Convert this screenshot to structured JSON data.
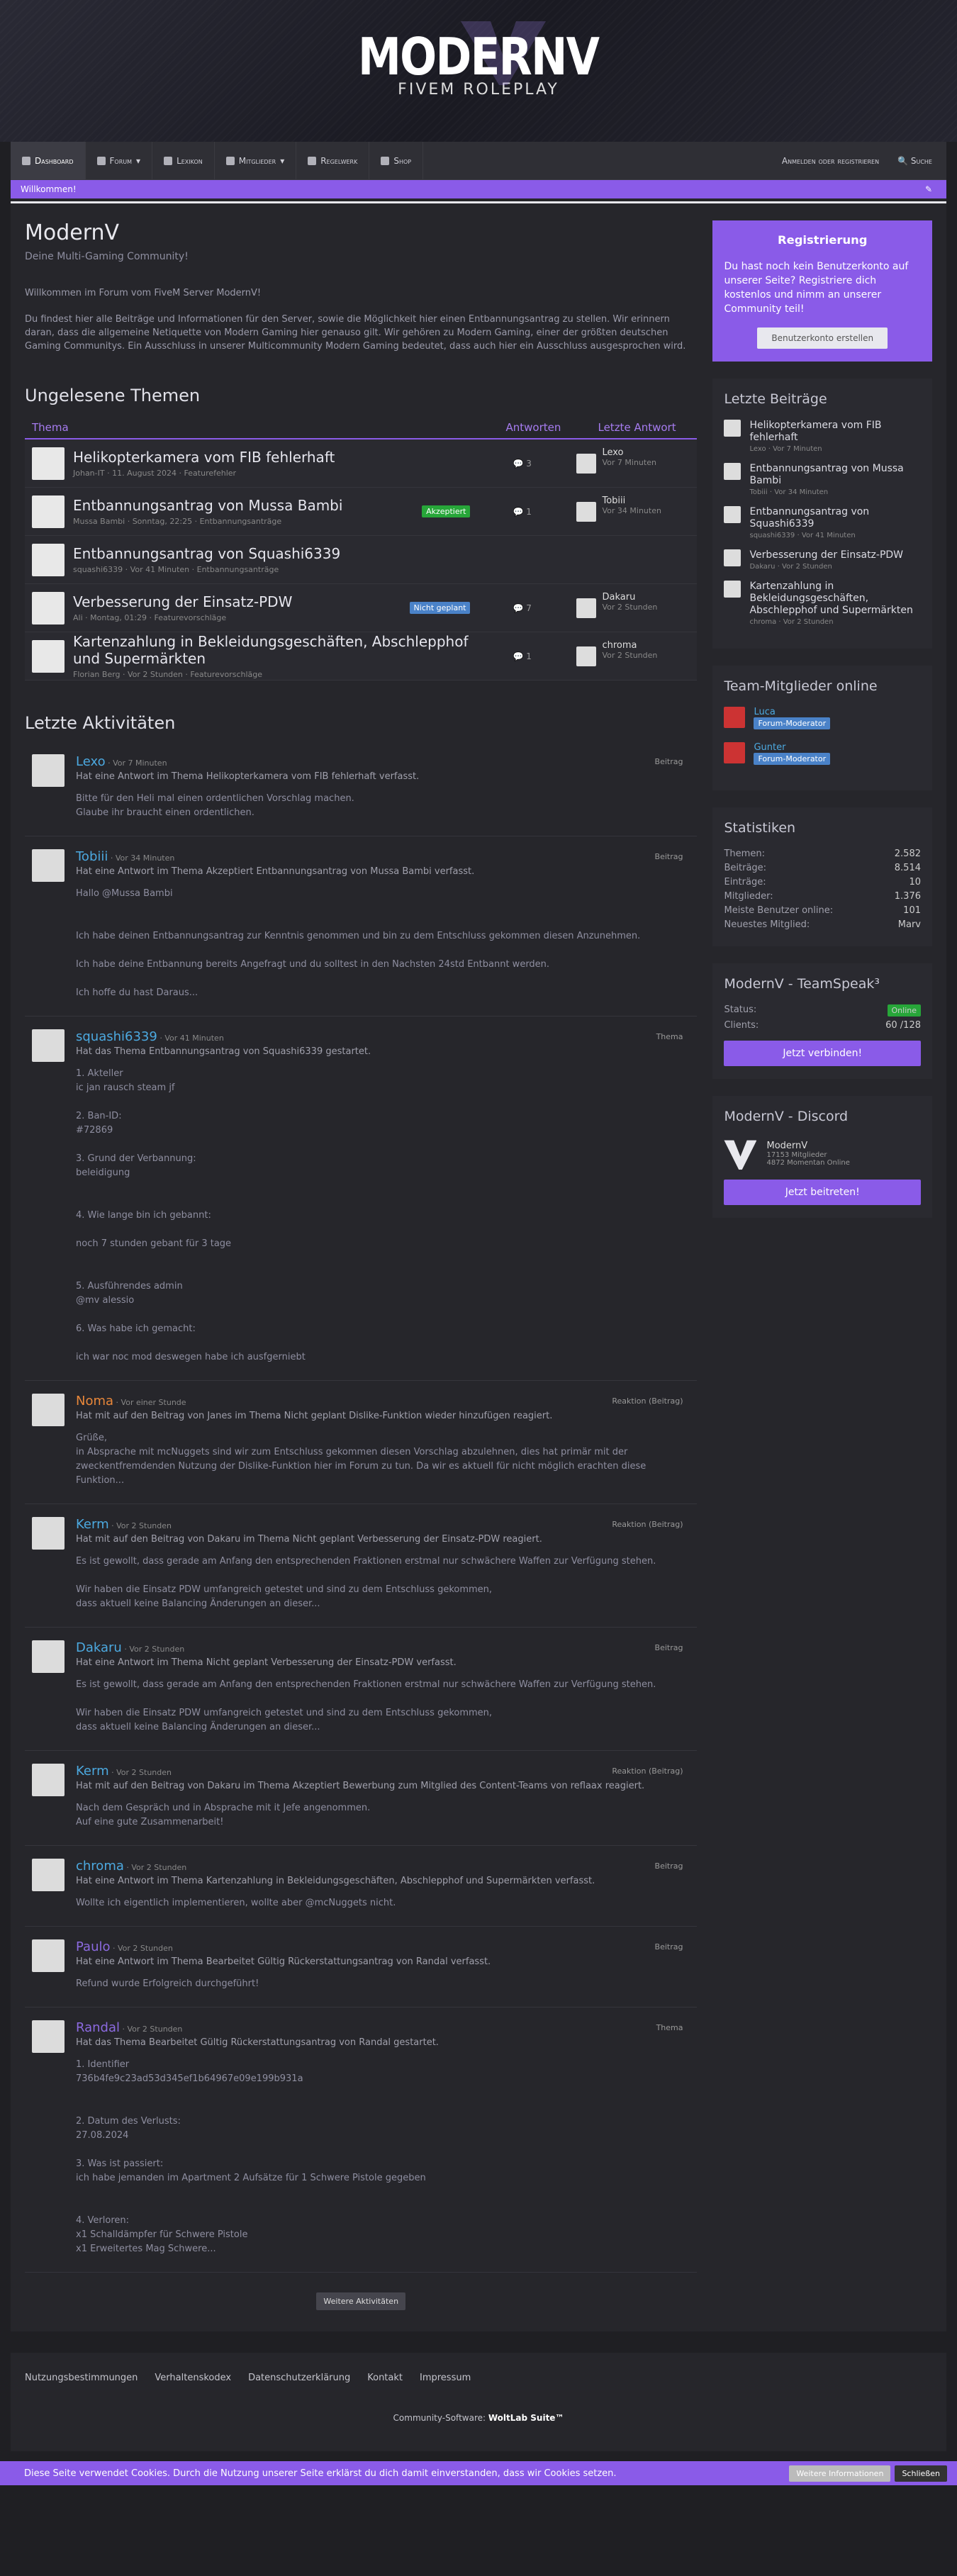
{
  "header": {
    "logo_big": "MODERNV",
    "logo_small": "FIVEM ROLEPLAY"
  },
  "nav": {
    "items": [
      {
        "label": "Dashboard"
      },
      {
        "label": "Forum"
      },
      {
        "label": "Lexikon"
      },
      {
        "label": "Mitglieder"
      },
      {
        "label": "Regelwerk"
      },
      {
        "label": "Shop"
      }
    ],
    "login": "Anmelden oder registrieren",
    "search": "Suche"
  },
  "welcome": {
    "text": "Willkommen!"
  },
  "page": {
    "title": "ModernV",
    "subtitle": "Deine Multi-Gaming Community!",
    "intro1": "Willkommen im Forum vom FiveM Server ModernV!",
    "intro2": "Du findest hier alle Beiträge und Informationen für den Server, sowie die Möglichkeit hier einen Entbannungsantrag zu stellen. Wir erinnern daran, dass die allgemeine Netiquette von Modern Gaming hier genauso gilt. Wir gehören zu Modern Gaming, einer der größten deutschen Gaming Communitys. Ein Ausschluss in unserer Multicommunity Modern Gaming bedeutet, dass auch hier ein Ausschluss ausgesprochen wird."
  },
  "unread": {
    "heading": "Ungelesene Themen",
    "col_topic": "Thema",
    "col_answers": "Antworten",
    "col_last": "Letzte Antwort",
    "rows": [
      {
        "title": "Helikopterkamera vom FIB fehlerhaft",
        "meta": "Johan-IT · 11. August 2024 · Featurefehler",
        "answers": "3",
        "last_user": "Lexo",
        "last_time": "Vor 7 Minuten",
        "badge": ""
      },
      {
        "title": "Entbannungsantrag von Mussa Bambi",
        "meta": "Mussa Bambi · Sonntag, 22:25 · Entbannungsanträge",
        "answers": "1",
        "last_user": "Tobiii",
        "last_time": "Vor 34 Minuten",
        "badge": "Akzeptiert"
      },
      {
        "title": "Entbannungsantrag von Squashi6339",
        "meta": "squashi6339 · Vor 41 Minuten · Entbannungsanträge",
        "answers": "",
        "last_user": "",
        "last_time": "",
        "badge": ""
      },
      {
        "title": "Verbesserung der Einsatz-PDW",
        "meta": "Ali · Montag, 01:29 · Featurevorschläge",
        "answers": "7",
        "last_user": "Dakaru",
        "last_time": "Vor 2 Stunden",
        "badge": "Nicht geplant"
      },
      {
        "title": "Kartenzahlung in Bekleidungsgeschäften, Abschlepphof und Supermärkten",
        "meta": "Florian Berg · Vor 2 Stunden · Featurevorschläge",
        "answers": "1",
        "last_user": "chroma",
        "last_time": "Vor 2 Stunden",
        "badge": ""
      }
    ]
  },
  "activity": {
    "heading": "Letzte Aktivitäten",
    "items": [
      {
        "user": "Lexo",
        "time": "Vor 7 Minuten",
        "type": "Beitrag",
        "line": "Hat eine Antwort im Thema Helikopterkamera vom FIB fehlerhaft verfasst.",
        "excerpt": "Bitte für den Heli mal einen ordentlichen Vorschlag machen.\nGlaube ihr braucht einen ordentlichen."
      },
      {
        "user": "Tobiii",
        "time": "Vor 34 Minuten",
        "type": "Beitrag",
        "line": "Hat eine Antwort im Thema Akzeptiert Entbannungsantrag von Mussa Bambi verfasst.",
        "excerpt": "Hallo @Mussa Bambi\n\n\nIch habe deinen Entbannungsantrag zur Kenntnis genommen und bin zu dem Entschluss gekommen diesen Anzunehmen.\n\nIch habe deine Entbannung bereits Angefragt und du solltest in den Nachsten 24std Entbannt werden.\n\nIch hoffe du hast Daraus..."
      },
      {
        "user": "squashi6339",
        "time": "Vor 41 Minuten",
        "type": "Thema",
        "line": "Hat das Thema Entbannungsantrag von Squashi6339 gestartet.",
        "excerpt": "1. Akteller\nic jan rausch steam jf\n\n2. Ban-ID:\n#72869\n\n3. Grund der Verbannung:\nbeleidigung\n\n\n4. Wie lange bin ich gebannt:\n\nnoch 7 stunden gebant für 3 tage\n\n\n5. Ausführendes admin\n@mv alessio\n\n6. Was habe ich gemacht:\n\nich war noc mod deswegen habe ich ausfgerniebt"
      },
      {
        "user": "Noma",
        "time": "Vor einer Stunde",
        "type": "Reaktion (Beitrag)",
        "line": "Hat mit auf den Beitrag von Janes im Thema Nicht geplant Dislike-Funktion wieder hinzufügen reagiert.",
        "excerpt": "Grüße,\nin Absprache mit mcNuggets sind wir zum Entschluss gekommen diesen Vorschlag abzulehnen, dies hat primär mit der zweckentfremdenden Nutzung der Dislike-Funktion hier im Forum zu tun. Da wir es aktuell für nicht möglich erachten diese Funktion..."
      },
      {
        "user": "Kerm",
        "time": "Vor 2 Stunden",
        "type": "Reaktion (Beitrag)",
        "line": "Hat mit auf den Beitrag von Dakaru im Thema Nicht geplant Verbesserung der Einsatz-PDW reagiert.",
        "excerpt": "Es ist gewollt, dass gerade am Anfang den entsprechenden Fraktionen erstmal nur schwächere Waffen zur Verfügung stehen.\n\nWir haben die Einsatz PDW umfangreich getestet und sind zu dem Entschluss gekommen,\ndass aktuell keine Balancing Änderungen an dieser..."
      },
      {
        "user": "Dakaru",
        "time": "Vor 2 Stunden",
        "type": "Beitrag",
        "line": "Hat eine Antwort im Thema Nicht geplant Verbesserung der Einsatz-PDW verfasst.",
        "excerpt": "Es ist gewollt, dass gerade am Anfang den entsprechenden Fraktionen erstmal nur schwächere Waffen zur Verfügung stehen.\n\nWir haben die Einsatz PDW umfangreich getestet und sind zu dem Entschluss gekommen,\ndass aktuell keine Balancing Änderungen an dieser..."
      },
      {
        "user": "Kerm",
        "time": "Vor 2 Stunden",
        "type": "Reaktion (Beitrag)",
        "line": "Hat mit auf den Beitrag von Dakaru im Thema Akzeptiert Bewerbung zum Mitglied des Content-Teams von reflaax reagiert.",
        "excerpt": "Nach dem Gespräch und in Absprache mit it Jefe angenommen.\nAuf eine gute Zusammenarbeit!"
      },
      {
        "user": "chroma",
        "time": "Vor 2 Stunden",
        "type": "Beitrag",
        "line": "Hat eine Antwort im Thema Kartenzahlung in Bekleidungsgeschäften, Abschlepphof und Supermärkten verfasst.",
        "excerpt": "Wollte ich eigentlich implementieren, wollte aber @mcNuggets nicht."
      },
      {
        "user": "Paulo",
        "time": "Vor 2 Stunden",
        "type": "Beitrag",
        "line": "Hat eine Antwort im Thema Bearbeitet Gültig Rückerstattungsantrag von Randal verfasst.",
        "excerpt": "Refund wurde Erfolgreich durchgeführt!"
      },
      {
        "user": "Randal",
        "time": "Vor 2 Stunden",
        "type": "Thema",
        "line": "Hat das Thema Bearbeitet Gültig Rückerstattungsantrag von Randal gestartet.",
        "excerpt": "1. Identifier\n736b4fe9c23ad53d345ef1b64967e09e199b931a\n\n\n2. Datum des Verlusts:\n27.08.2024\n\n3. Was ist passiert:\nich habe jemanden im Apartment 2 Aufsätze für 1 Schwere Pistole gegeben\n\n\n4. Verloren:\nx1 Schalldämpfer für Schwere Pistole\nx1 Erweitertes Mag Schwere..."
      }
    ],
    "more": "Weitere Aktivitäten"
  },
  "sidebar": {
    "register": {
      "title": "Registrierung",
      "text": "Du hast noch kein Benutzerkonto auf unserer Seite? Registriere dich kostenlos und nimm an unserer Community teil!",
      "button": "Benutzerkonto erstellen"
    },
    "latest": {
      "title": "Letzte Beiträge",
      "items": [
        {
          "title": "Helikopterkamera vom FIB fehlerhaft",
          "meta": "Lexo · Vor 7 Minuten"
        },
        {
          "title": "Entbannungsantrag von Mussa Bambi",
          "meta": "Tobiii · Vor 34 Minuten"
        },
        {
          "title": "Entbannungsantrag von Squashi6339",
          "meta": "squashi6339 · Vor 41 Minuten"
        },
        {
          "title": "Verbesserung der Einsatz-PDW",
          "meta": "Dakaru · Vor 2 Stunden"
        },
        {
          "title": "Kartenzahlung in Bekleidungsgeschäften, Abschlepphof und Supermärkten",
          "meta": "chroma · Vor 2 Stunden"
        }
      ]
    },
    "team": {
      "title": "Team-Mitglieder online",
      "members": [
        {
          "name": "Luca",
          "role": "Forum-Moderator"
        },
        {
          "name": "Gunter",
          "role": "Forum-Moderator"
        }
      ]
    },
    "stats": {
      "title": "Statistiken",
      "rows": [
        {
          "label": "Themen:",
          "value": "2.582"
        },
        {
          "label": "Beiträge:",
          "value": "8.514"
        },
        {
          "label": "Einträge:",
          "value": "10"
        },
        {
          "label": "Mitglieder:",
          "value": "1.376"
        },
        {
          "label": "Meiste Benutzer online:",
          "value": "101"
        },
        {
          "label": "Neuestes Mitglied:",
          "value": "Marv"
        }
      ]
    },
    "teamspeak": {
      "title": "ModernV - TeamSpeak³",
      "status_label": "Status:",
      "status": "Online",
      "clients_label": "Clients:",
      "clients": "60 /128",
      "button": "Jetzt verbinden!"
    },
    "discord": {
      "title": "ModernV - Discord",
      "name": "ModernV",
      "members": "17153 Mitglieder",
      "online": "4872 Momentan Online",
      "button": "Jetzt beitreten!"
    }
  },
  "footer": {
    "links": [
      "Nutzungsbestimmungen",
      "Verhaltenskodex",
      "Datenschutzerklärung",
      "Kontakt",
      "Impressum"
    ],
    "copyright_pre": "Community-Software: ",
    "copyright_brand": "WoltLab Suite™"
  },
  "cookie": {
    "text": "Diese Seite verwendet Cookies. Durch die Nutzung unserer Seite erklärst du dich damit einverstanden, dass wir Cookies setzen.",
    "more": "Weitere Informationen",
    "close": "Schließen"
  }
}
